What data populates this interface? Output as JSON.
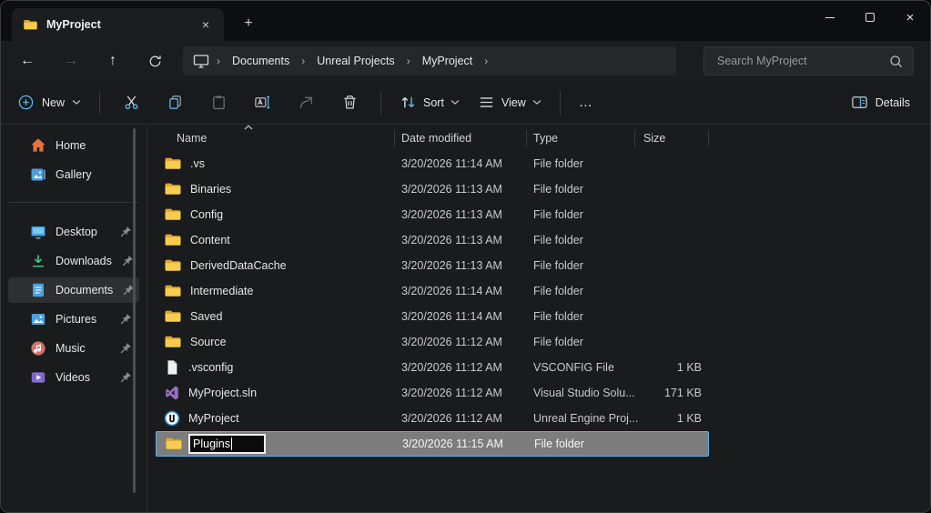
{
  "window": {
    "tab_title": "MyProject"
  },
  "nav": {
    "breadcrumb": [
      "Documents",
      "Unreal Projects",
      "MyProject"
    ],
    "search_placeholder": "Search MyProject"
  },
  "toolbar": {
    "new_label": "New",
    "sort_label": "Sort",
    "view_label": "View",
    "more_label": "…",
    "details_label": "Details"
  },
  "sidebar": {
    "items": [
      {
        "label": "Home",
        "icon": "home-icon",
        "pinned": false,
        "selected": false
      },
      {
        "label": "Gallery",
        "icon": "gallery-icon",
        "pinned": false,
        "selected": false
      },
      {
        "divider": true
      },
      {
        "label": "Desktop",
        "icon": "desktop-icon",
        "pinned": true,
        "selected": false
      },
      {
        "label": "Downloads",
        "icon": "downloads-icon",
        "pinned": true,
        "selected": false
      },
      {
        "label": "Documents",
        "icon": "documents-icon",
        "pinned": true,
        "selected": true
      },
      {
        "label": "Pictures",
        "icon": "pictures-icon",
        "pinned": true,
        "selected": false
      },
      {
        "label": "Music",
        "icon": "music-icon",
        "pinned": true,
        "selected": false
      },
      {
        "label": "Videos",
        "icon": "videos-icon",
        "pinned": true,
        "selected": false
      }
    ]
  },
  "columns": [
    "Name",
    "Date modified",
    "Type",
    "Size"
  ],
  "files": [
    {
      "name": ".vs",
      "date": "3/20/2026 11:14 AM",
      "type": "File folder",
      "size": "",
      "icon": "folder-icon",
      "editing": false
    },
    {
      "name": "Binaries",
      "date": "3/20/2026 11:13 AM",
      "type": "File folder",
      "size": "",
      "icon": "folder-icon",
      "editing": false
    },
    {
      "name": "Config",
      "date": "3/20/2026 11:13 AM",
      "type": "File folder",
      "size": "",
      "icon": "folder-icon",
      "editing": false
    },
    {
      "name": "Content",
      "date": "3/20/2026 11:13 AM",
      "type": "File folder",
      "size": "",
      "icon": "folder-icon",
      "editing": false
    },
    {
      "name": "DerivedDataCache",
      "date": "3/20/2026 11:13 AM",
      "type": "File folder",
      "size": "",
      "icon": "folder-icon",
      "editing": false
    },
    {
      "name": "Intermediate",
      "date": "3/20/2026 11:14 AM",
      "type": "File folder",
      "size": "",
      "icon": "folder-icon",
      "editing": false
    },
    {
      "name": "Saved",
      "date": "3/20/2026 11:14 AM",
      "type": "File folder",
      "size": "",
      "icon": "folder-icon",
      "editing": false
    },
    {
      "name": "Source",
      "date": "3/20/2026 11:12 AM",
      "type": "File folder",
      "size": "",
      "icon": "folder-icon",
      "editing": false
    },
    {
      "name": ".vsconfig",
      "date": "3/20/2026 11:12 AM",
      "type": "VSCONFIG File",
      "size": "1 KB",
      "icon": "file-icon",
      "editing": false
    },
    {
      "name": "MyProject.sln",
      "date": "3/20/2026 11:12 AM",
      "type": "Visual Studio Solu...",
      "size": "171 KB",
      "icon": "visual-studio-icon",
      "editing": false
    },
    {
      "name": "MyProject",
      "date": "3/20/2026 11:12 AM",
      "type": "Unreal Engine Proj...",
      "size": "1 KB",
      "icon": "unreal-engine-icon",
      "editing": false
    },
    {
      "name": "Plugins",
      "date": "3/20/2026 11:15 AM",
      "type": "File folder",
      "size": "",
      "icon": "folder-icon",
      "editing": true
    }
  ],
  "colors": {
    "accent_blue": "#5ab3e8",
    "folder_yellow": "#f7cc4f",
    "edit_row_gray": "#7d7d7d",
    "background": "#1a1b1d",
    "titlebar": "#0d0e11"
  }
}
